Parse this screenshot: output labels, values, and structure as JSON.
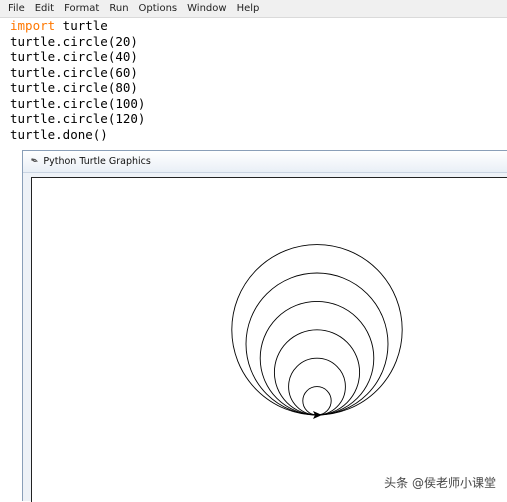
{
  "menu": [
    "File",
    "Edit",
    "Format",
    "Run",
    "Options",
    "Window",
    "Help"
  ],
  "code": {
    "import_keyword": "import",
    "import_module": " turtle",
    "lines": [
      "turtle.circle(20)",
      "turtle.circle(40)",
      "turtle.circle(60)",
      "turtle.circle(80)",
      "turtle.circle(100)",
      "turtle.circle(120)",
      "turtle.done()"
    ],
    "keyword_color": "#ff7700"
  },
  "turtle_window": {
    "title": "Python Turtle Graphics",
    "icon": "feather-icon",
    "circle_radii": [
      20,
      40,
      60,
      80,
      100,
      120
    ],
    "pen_color": "#000000"
  },
  "watermark": "头条 @侯老师小课堂"
}
